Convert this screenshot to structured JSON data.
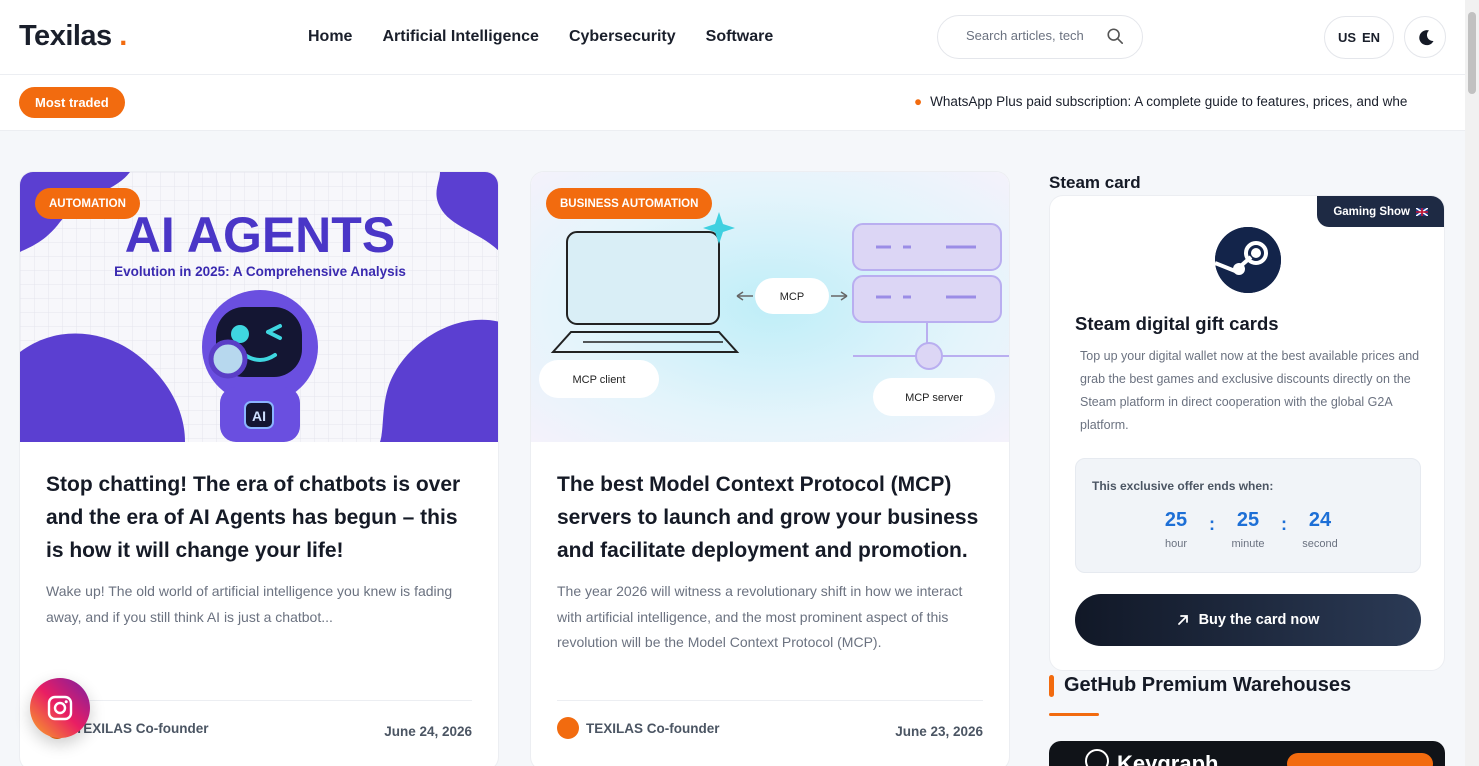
{
  "header": {
    "logo": "Texilas",
    "logo_dot": ".",
    "nav": [
      "Home",
      "Artificial Intelligence",
      "Cybersecurity",
      "Software"
    ],
    "search_placeholder": "Search articles, tech",
    "lang_flag": "US",
    "lang_code": "EN"
  },
  "ticker": {
    "pill": "Most traded",
    "text": "WhatsApp Plus paid subscription: A complete guide to features, prices, and whe"
  },
  "cards": [
    {
      "tag": "AUTOMATION",
      "image_title": "AI AGENTS",
      "image_subtitle": "Evolution in 2025:  A Comprehensive Analysis",
      "image_badge": "AI",
      "title": "Stop chatting! The era of chatbots is over and the era of AI Agents has begun – this is how it will change your life!",
      "excerpt": "Wake up! The old world of artificial intelligence you knew is fading away, and if you still think AI is just a chatbot...",
      "author": "TEXILAS Co-founder",
      "date": "June 24, 2026"
    },
    {
      "tag": "BUSINESS AUTOMATION",
      "image_labels": {
        "mcp": "MCP",
        "client": "MCP client",
        "server": "MCP server"
      },
      "title": "The best Model Context Protocol (MCP) servers to launch and grow your business and facilitate deployment and promotion.",
      "excerpt": "The year 2026 will witness a revolutionary shift in how we interact with artificial intelligence, and the most prominent aspect of this revolution will be the Model Context Protocol (MCP).",
      "author": "TEXILAS Co-founder",
      "date": "June 23, 2026"
    }
  ],
  "sidebar": {
    "steam_section_title": "Steam card",
    "badge": "Gaming Show",
    "heading": "Steam digital gift cards",
    "description": "Top up your digital wallet now at the best available prices and grab the best games and exclusive discounts directly on the Steam platform in direct cooperation with the global G2A platform.",
    "offer_label": "This exclusive offer ends when:",
    "countdown": [
      {
        "value": "25",
        "unit": "hour"
      },
      {
        "value": "25",
        "unit": "minute"
      },
      {
        "value": "24",
        "unit": "second"
      }
    ],
    "separator": ":",
    "buy_label": "Buy the card now",
    "gethub_title": "GetHub Premium Warehouses",
    "keygraph_name": "Keygraph"
  },
  "colors": {
    "accent": "#f26b0f",
    "dark": "#151a26",
    "countdown": "#1d6fd6"
  },
  "icons": [
    "search-icon",
    "moon-icon",
    "steam-icon",
    "arrow-up-right-icon",
    "instagram-icon",
    "uk-flag-icon"
  ]
}
